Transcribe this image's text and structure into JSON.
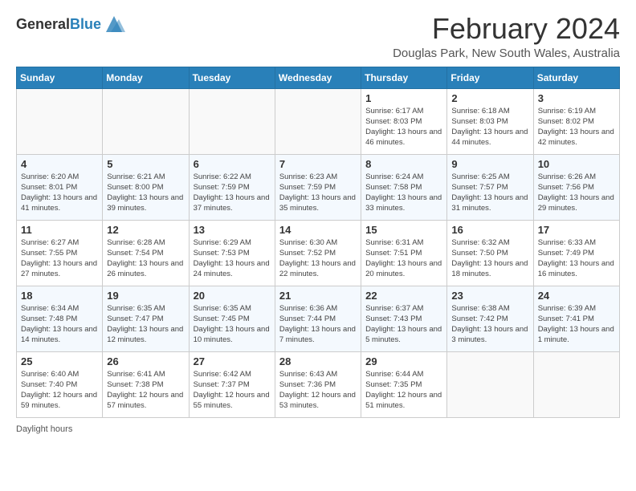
{
  "header": {
    "logo_general": "General",
    "logo_blue": "Blue",
    "month_title": "February 2024",
    "location": "Douglas Park, New South Wales, Australia"
  },
  "footer": {
    "note": "Daylight hours"
  },
  "days_of_week": [
    "Sunday",
    "Monday",
    "Tuesday",
    "Wednesday",
    "Thursday",
    "Friday",
    "Saturday"
  ],
  "weeks": [
    [
      {
        "day": "",
        "empty": true
      },
      {
        "day": "",
        "empty": true
      },
      {
        "day": "",
        "empty": true
      },
      {
        "day": "",
        "empty": true
      },
      {
        "day": "1",
        "sunrise": "6:17 AM",
        "sunset": "8:03 PM",
        "daylight": "13 hours and 46 minutes."
      },
      {
        "day": "2",
        "sunrise": "6:18 AM",
        "sunset": "8:03 PM",
        "daylight": "13 hours and 44 minutes."
      },
      {
        "day": "3",
        "sunrise": "6:19 AM",
        "sunset": "8:02 PM",
        "daylight": "13 hours and 42 minutes."
      }
    ],
    [
      {
        "day": "4",
        "sunrise": "6:20 AM",
        "sunset": "8:01 PM",
        "daylight": "13 hours and 41 minutes."
      },
      {
        "day": "5",
        "sunrise": "6:21 AM",
        "sunset": "8:00 PM",
        "daylight": "13 hours and 39 minutes."
      },
      {
        "day": "6",
        "sunrise": "6:22 AM",
        "sunset": "7:59 PM",
        "daylight": "13 hours and 37 minutes."
      },
      {
        "day": "7",
        "sunrise": "6:23 AM",
        "sunset": "7:59 PM",
        "daylight": "13 hours and 35 minutes."
      },
      {
        "day": "8",
        "sunrise": "6:24 AM",
        "sunset": "7:58 PM",
        "daylight": "13 hours and 33 minutes."
      },
      {
        "day": "9",
        "sunrise": "6:25 AM",
        "sunset": "7:57 PM",
        "daylight": "13 hours and 31 minutes."
      },
      {
        "day": "10",
        "sunrise": "6:26 AM",
        "sunset": "7:56 PM",
        "daylight": "13 hours and 29 minutes."
      }
    ],
    [
      {
        "day": "11",
        "sunrise": "6:27 AM",
        "sunset": "7:55 PM",
        "daylight": "13 hours and 27 minutes."
      },
      {
        "day": "12",
        "sunrise": "6:28 AM",
        "sunset": "7:54 PM",
        "daylight": "13 hours and 26 minutes."
      },
      {
        "day": "13",
        "sunrise": "6:29 AM",
        "sunset": "7:53 PM",
        "daylight": "13 hours and 24 minutes."
      },
      {
        "day": "14",
        "sunrise": "6:30 AM",
        "sunset": "7:52 PM",
        "daylight": "13 hours and 22 minutes."
      },
      {
        "day": "15",
        "sunrise": "6:31 AM",
        "sunset": "7:51 PM",
        "daylight": "13 hours and 20 minutes."
      },
      {
        "day": "16",
        "sunrise": "6:32 AM",
        "sunset": "7:50 PM",
        "daylight": "13 hours and 18 minutes."
      },
      {
        "day": "17",
        "sunrise": "6:33 AM",
        "sunset": "7:49 PM",
        "daylight": "13 hours and 16 minutes."
      }
    ],
    [
      {
        "day": "18",
        "sunrise": "6:34 AM",
        "sunset": "7:48 PM",
        "daylight": "13 hours and 14 minutes."
      },
      {
        "day": "19",
        "sunrise": "6:35 AM",
        "sunset": "7:47 PM",
        "daylight": "13 hours and 12 minutes."
      },
      {
        "day": "20",
        "sunrise": "6:35 AM",
        "sunset": "7:45 PM",
        "daylight": "13 hours and 10 minutes."
      },
      {
        "day": "21",
        "sunrise": "6:36 AM",
        "sunset": "7:44 PM",
        "daylight": "13 hours and 7 minutes."
      },
      {
        "day": "22",
        "sunrise": "6:37 AM",
        "sunset": "7:43 PM",
        "daylight": "13 hours and 5 minutes."
      },
      {
        "day": "23",
        "sunrise": "6:38 AM",
        "sunset": "7:42 PM",
        "daylight": "13 hours and 3 minutes."
      },
      {
        "day": "24",
        "sunrise": "6:39 AM",
        "sunset": "7:41 PM",
        "daylight": "13 hours and 1 minute."
      }
    ],
    [
      {
        "day": "25",
        "sunrise": "6:40 AM",
        "sunset": "7:40 PM",
        "daylight": "12 hours and 59 minutes."
      },
      {
        "day": "26",
        "sunrise": "6:41 AM",
        "sunset": "7:38 PM",
        "daylight": "12 hours and 57 minutes."
      },
      {
        "day": "27",
        "sunrise": "6:42 AM",
        "sunset": "7:37 PM",
        "daylight": "12 hours and 55 minutes."
      },
      {
        "day": "28",
        "sunrise": "6:43 AM",
        "sunset": "7:36 PM",
        "daylight": "12 hours and 53 minutes."
      },
      {
        "day": "29",
        "sunrise": "6:44 AM",
        "sunset": "7:35 PM",
        "daylight": "12 hours and 51 minutes."
      },
      {
        "day": "",
        "empty": true
      },
      {
        "day": "",
        "empty": true
      }
    ]
  ]
}
